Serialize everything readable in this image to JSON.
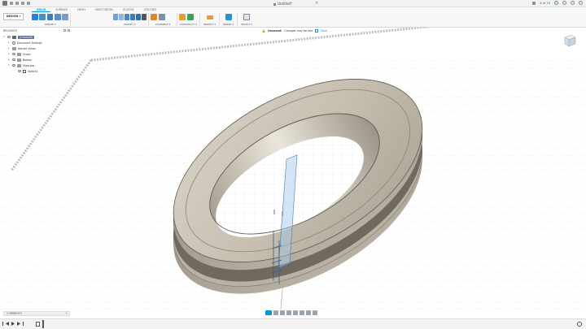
{
  "title_bar": {
    "document_title": "Untitled*",
    "close_glyph": "×",
    "jobs_label": "4 of 10"
  },
  "ribbon": {
    "workspace_button": "DESIGN ▾",
    "tabs": [
      "SOLID",
      "SURFACE",
      "MESH",
      "SHEET METAL",
      "PLASTIC",
      "UTILITIES"
    ],
    "active_tab": "SOLID",
    "groups": [
      "CREATE ▾",
      "MODIFY ▾",
      "ASSEMBLE ▾",
      "CONSTRUCT ▾",
      "INSPECT ▾",
      "INSERT ▾",
      "SELECT ▾"
    ]
  },
  "browser": {
    "header": "BROWSER",
    "items": [
      {
        "label": "(Unsaved)",
        "level": 0,
        "kind": "root"
      },
      {
        "label": "Document Settings",
        "level": 1,
        "kind": "settings"
      },
      {
        "label": "Named Views",
        "level": 1,
        "kind": "folder"
      },
      {
        "label": "Origin",
        "level": 1,
        "kind": "folder"
      },
      {
        "label": "Bodies",
        "level": 1,
        "kind": "folder"
      },
      {
        "label": "Sketches",
        "level": 1,
        "kind": "folder"
      },
      {
        "label": "Sketch1",
        "level": 2,
        "kind": "sketch"
      }
    ]
  },
  "notification": {
    "status": "Unsaved:",
    "message": "Changes may be lost",
    "action": "Save"
  },
  "comments": {
    "label": "COMMENTS",
    "add_glyph": "+"
  },
  "colors": {
    "accent": "#0696d7",
    "ring_body": "#c9c1b3",
    "ring_shadow": "#8e877b",
    "grid": "#e3e3e3"
  }
}
